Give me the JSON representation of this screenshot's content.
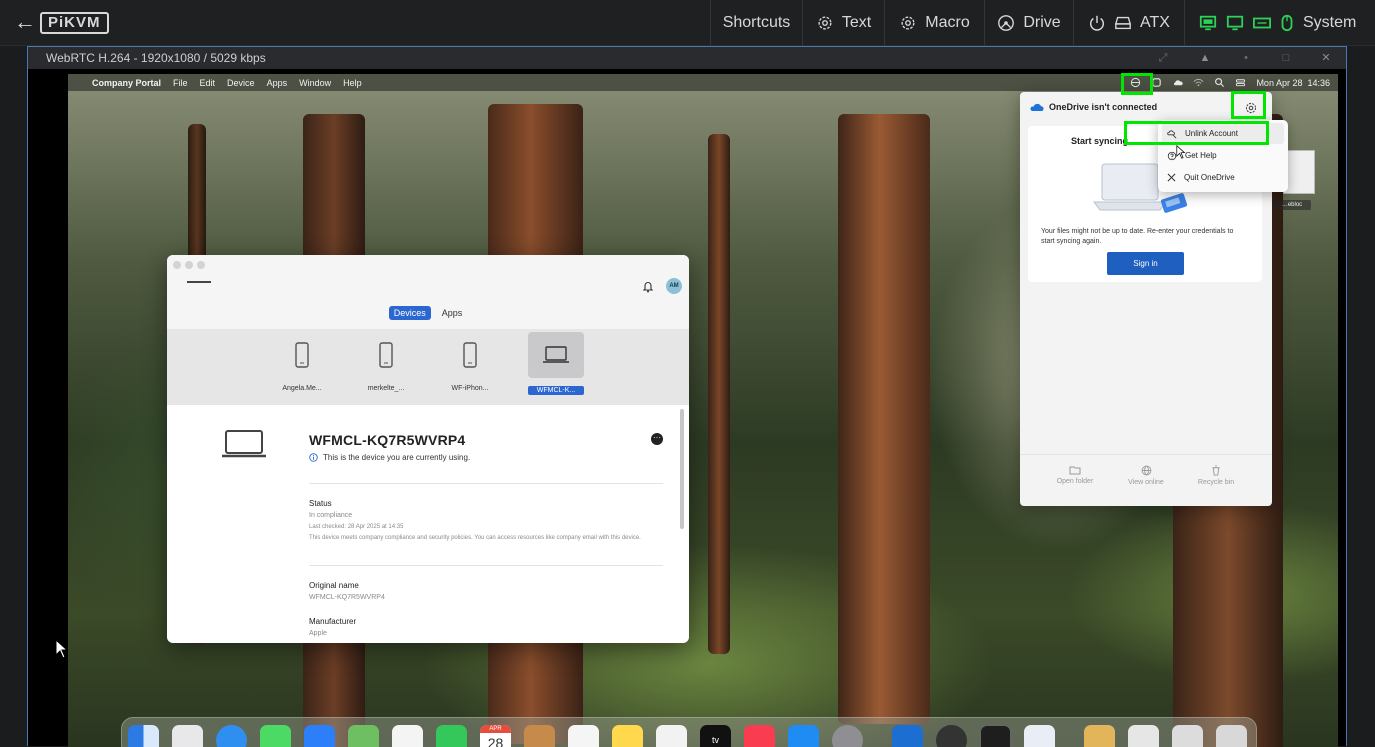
{
  "kvm": {
    "back": "←",
    "logo": "PiKVM",
    "menus": {
      "shortcuts": "Shortcuts",
      "text": "Text",
      "macro": "Macro",
      "drive": "Drive",
      "atx": "ATX",
      "system": "System"
    }
  },
  "stream": {
    "title": "WebRTC H.264 - 1920x1080 / 5029 kbps"
  },
  "mac": {
    "menubar": {
      "app": "Company Portal",
      "items": [
        "File",
        "Edit",
        "Device",
        "Apps",
        "Window",
        "Help"
      ],
      "clock": "Mon Apr 28  14:36"
    },
    "desktop_file_label": "…ebloc"
  },
  "company_portal": {
    "avatar": "AM",
    "tabs": {
      "devices": "Devices",
      "apps": "Apps"
    },
    "devices": [
      "Angela.Me...",
      "merkelte_...",
      "WF-iPhon...",
      "WFMCL-K..."
    ],
    "device_name": "WFMCL-KQ7R5WVRP4",
    "current_notice": "This is the device you are currently using.",
    "status_label": "Status",
    "status_value": "In compliance",
    "last_checked": "Last checked: 28 Apr 2025 at 14:35",
    "status_desc": "This device meets company compliance and security policies. You can access resources like company email with this device.",
    "original_name_label": "Original name",
    "original_name_value": "WFMCL-KQ7R5WVRP4",
    "manufacturer_label": "Manufacturer",
    "manufacturer_value": "Apple"
  },
  "onedrive": {
    "title": "OneDrive isn't connected",
    "start_syncing": "Start syncing",
    "message": "Your files might not be up to date. Re-enter your credentials to start syncing again.",
    "sign_in": "Sign in",
    "footer": {
      "open_folder": "Open folder",
      "view_online": "View online",
      "recycle_bin": "Recycle bin"
    },
    "menu": {
      "unlink": "Unlink Account",
      "help": "Get Help",
      "quit": "Quit OneDrive"
    }
  },
  "dock": {
    "calendar_month": "APR",
    "calendar_day": "28",
    "tv_label": "tv"
  },
  "colors": {
    "highlight": "#00e600",
    "accent": "#2c67d1",
    "signin": "#1e5fbf"
  }
}
